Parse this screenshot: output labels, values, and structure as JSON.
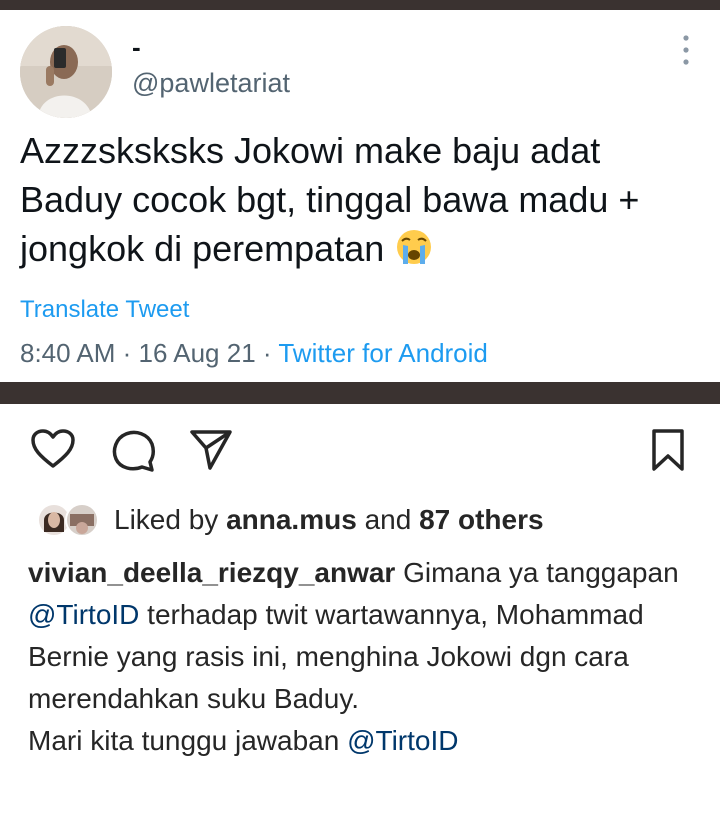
{
  "tweet": {
    "display_name": "-",
    "handle": "@pawletariat",
    "text": "Azzzsksksks Jokowi make baju adat Baduy cocok bgt, tinggal bawa madu + jongkok di perempatan",
    "emoji": "loudly-crying-face",
    "translate_label": "Translate Tweet",
    "time": "8:40 AM",
    "date": "16 Aug 21",
    "separator": "·",
    "source": "Twitter for Android"
  },
  "instagram": {
    "actions": [
      "heart-icon",
      "comment-icon",
      "share-icon",
      "bookmark-icon"
    ],
    "likes": {
      "prefix": "Liked by",
      "user": "anna.mus",
      "middle": "and",
      "others": "87 others"
    },
    "caption": {
      "username": "vivian_deella_riezqy_anwar",
      "part1": " Gimana ya tanggapan ",
      "mention1": "@TirtoID",
      "part2": " terhadap twit wartawannya,  Mohammad Bernie yang rasis ini, menghina Jokowi dgn cara merendahkan suku Baduy.",
      "part3": "Mari kita  tunggu jawaban ",
      "mention2": "@TirtoID"
    }
  },
  "colors": {
    "frame": "#3a3230",
    "link_blue": "#1d9bf0",
    "muted_gray": "#536471",
    "ig_text": "#262626",
    "ig_mention": "#00376b"
  }
}
